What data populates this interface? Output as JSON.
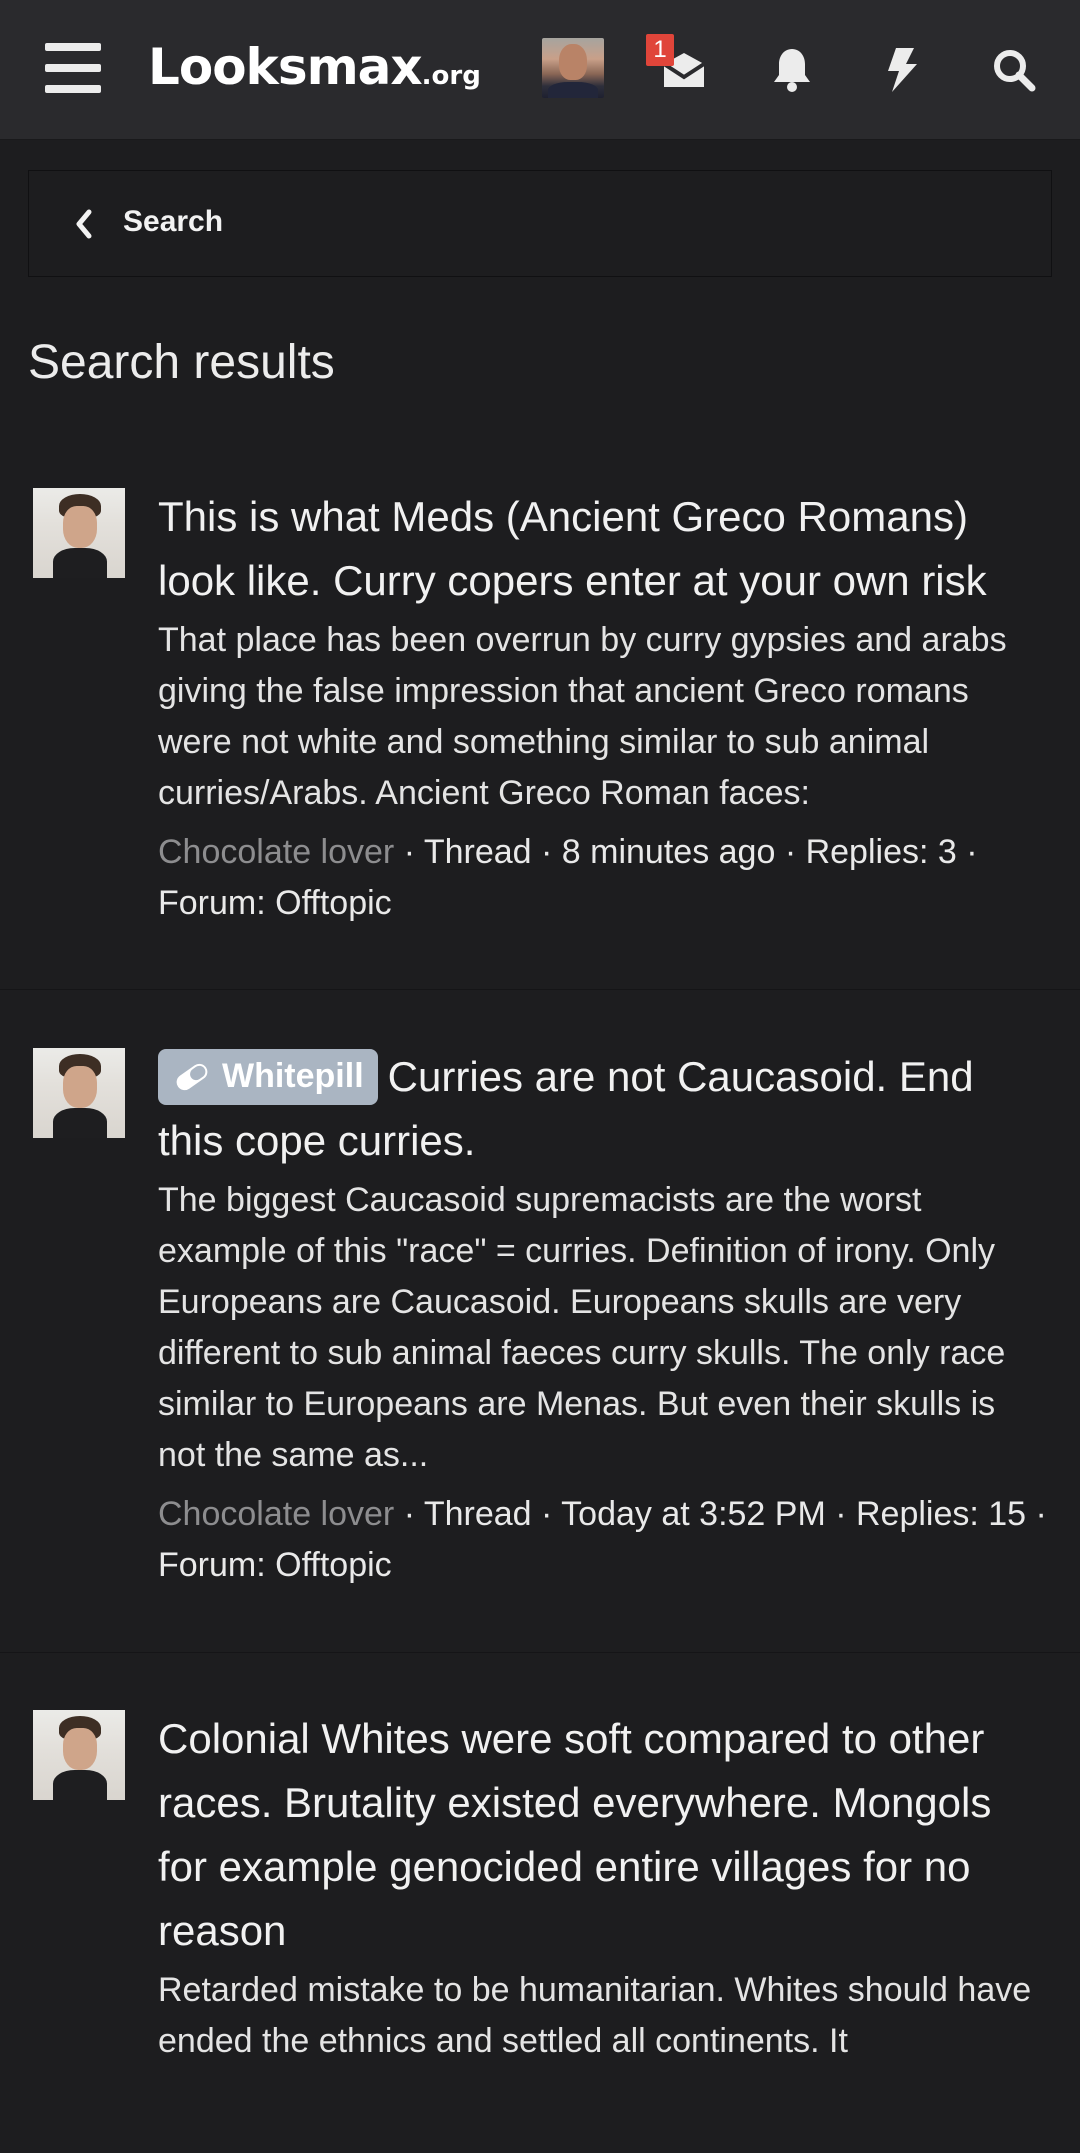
{
  "header": {
    "logo_main": "Looksmax",
    "logo_tld": ".org",
    "messages_badge": "1",
    "icons": [
      "menu-icon",
      "avatar",
      "inbox-icon",
      "bell-icon",
      "bolt-icon",
      "search-icon"
    ]
  },
  "breadcrumb": {
    "label": "Search"
  },
  "page": {
    "title": "Search results"
  },
  "results": [
    {
      "title": "This is what Meds (Ancient Greco Romans) look like. Curry copers enter at your own risk",
      "prefix": "",
      "snippet": "That place has been overrun by curry gypsies and arabs giving the false impression that ancient Greco romans were not white and something similar to sub animal curries/Arabs. Ancient Greco Roman faces:",
      "author": "Chocolate lover",
      "meta": " · Thread · 8 minutes ago · Replies: 3 · Forum: Offtopic"
    },
    {
      "title": "Curries are not Caucasoid. End this cope curries.",
      "prefix": "Whitepill",
      "snippet": "The biggest Caucasoid supremacists are the worst example of this \"race\" = curries. Definition of irony. Only Europeans are Caucasoid. Europeans skulls are very different to sub animal faeces curry skulls. The only race similar to Europeans are Menas. But even their skulls is not the same as...",
      "author": "Chocolate lover",
      "meta": " · Thread · Today at 3:52 PM · Replies: 15 · Forum: Offtopic"
    },
    {
      "title": "Colonial Whites were soft compared to other races. Brutality existed everywhere. Mongols for example genocided entire villages for no reason",
      "prefix": "",
      "snippet": "Retarded mistake to be humanitarian. Whites should have ended the ethnics and settled all continents. It",
      "author": "",
      "meta": ""
    }
  ],
  "colors": {
    "background": "#1d1d1f",
    "header": "#2a2a2d",
    "badge": "#e0453a",
    "prefix": "#aab5c2",
    "author": "#8d8d8f"
  }
}
